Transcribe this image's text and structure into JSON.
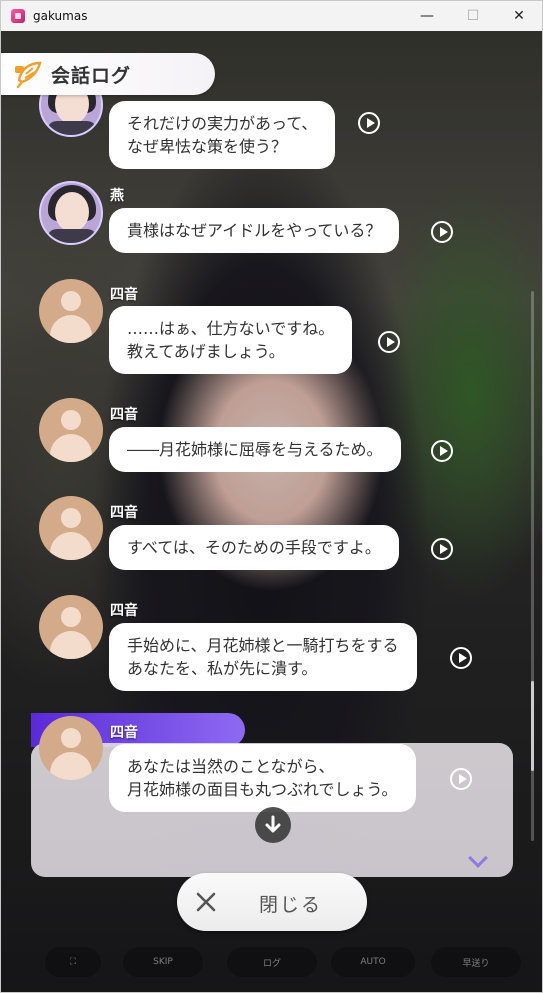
{
  "window": {
    "title": "gakumas",
    "controls": {
      "minimize": "—",
      "maximize": "☐",
      "close": "✕"
    }
  },
  "header": {
    "title": "会話ログ",
    "icon": "feather-speech-icon"
  },
  "messages": [
    {
      "speaker": "",
      "avatar": "annotated-portrait",
      "lines": [
        "それだけの実力があって、",
        "なぜ卑怯な策を使う？"
      ]
    },
    {
      "speaker": "燕",
      "avatar": "character-portrait",
      "lines": [
        "貴様はなぜアイドルをやっている？"
      ]
    },
    {
      "speaker": "四音",
      "avatar": "placeholder-person",
      "lines": [
        "……はぁ、仕方ないですね。",
        "教えてあげましょう。"
      ]
    },
    {
      "speaker": "四音",
      "avatar": "placeholder-person",
      "lines": [
        "――月花姉様に屈辱を与えるため。"
      ]
    },
    {
      "speaker": "四音",
      "avatar": "placeholder-person",
      "lines": [
        "すべては、そのための手段ですよ。"
      ]
    },
    {
      "speaker": "四音",
      "avatar": "placeholder-person",
      "lines": [
        "手始めに、月花姉様と一騎打ちをする",
        "あなたを、私が先に潰す。"
      ]
    },
    {
      "speaker": "四音",
      "avatar": "placeholder-person",
      "lines": [
        "あなたは当然のことながら、",
        "月花姉様の面目も丸つぶれでしょう。"
      ]
    }
  ],
  "close_button": {
    "label": "閉じる"
  },
  "background_controls": {
    "skip": "SKIP",
    "log": "ログ",
    "auto": "AUTO",
    "back": "早送り"
  },
  "colors": {
    "accent": "#5a2ad8",
    "bubble": "#ffffff",
    "avatar_placeholder": "#d3ab8b"
  }
}
